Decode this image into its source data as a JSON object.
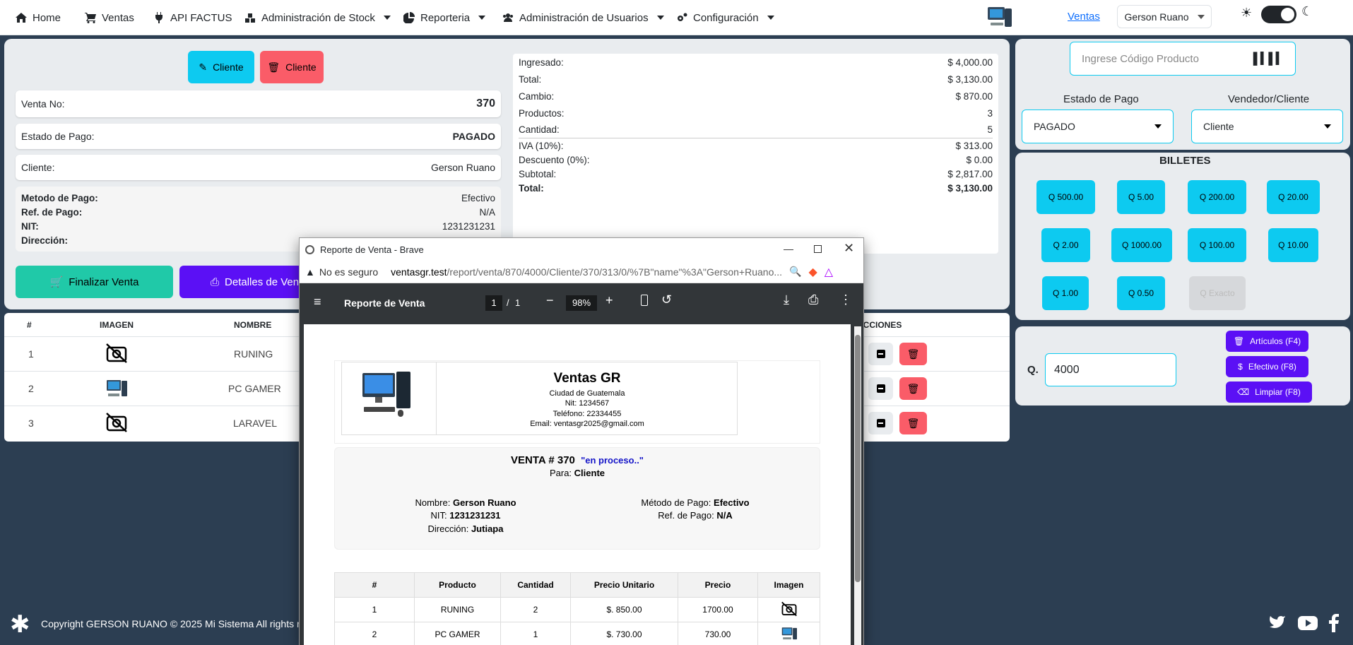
{
  "nav": {
    "home": "Home",
    "ventas": "Ventas",
    "api": "API FACTUS",
    "stock": "Administración de Stock",
    "reporteria": "Reporteria",
    "usuarios": "Administración de Usuarios",
    "config": "Configuración",
    "link_ventas": "Ventas",
    "user": "Gerson Ruano"
  },
  "left": {
    "btn_edit": "Cliente",
    "btn_delete": "Cliente",
    "venta_label": "Venta No:",
    "venta_value": "370",
    "estado_label": "Estado de Pago:",
    "estado_value": "PAGADO",
    "cliente_label": "Cliente:",
    "cliente_value": "Gerson Ruano",
    "metodo_label": "Metodo de Pago:",
    "metodo_value": "Efectivo",
    "ref_label": "Ref. de Pago:",
    "ref_value": "N/A",
    "nit_label": "NIT:",
    "nit_value": "1231231231",
    "dir_label": "Dirección:",
    "dir_value": "",
    "finalizar": "Finalizar Venta",
    "detalles": "Detalles de Venta"
  },
  "summary": {
    "ingresado_label": "Ingresado:",
    "ingresado": "$ 4,000.00",
    "total_label": "Total:",
    "total": "$ 3,130.00",
    "cambio_label": "Cambio:",
    "cambio": "$ 870.00",
    "productos_label": "Productos:",
    "productos": "3",
    "cantidad_label": "Cantidad:",
    "cantidad": "5",
    "iva_label": "IVA (10%):",
    "iva": "$ 313.00",
    "descuento_label": "Descuento (0%):",
    "descuento": "$ 0.00",
    "subtotal_label": "Subtotal:",
    "subtotal": "$ 2,817.00",
    "total2_label": "Total:",
    "total2": "$ 3,130.00"
  },
  "right": {
    "codigo_placeholder": "Ingrese Código Producto",
    "estado_title": "Estado de Pago",
    "estado_value": "PAGADO",
    "vendedor_title": "Vendedor/Cliente",
    "vendedor_value": "Cliente",
    "billetes_title": "BILLETES",
    "bills": [
      "Q 500.00",
      "Q 5.00",
      "Q 200.00",
      "Q 20.00",
      "Q 2.00",
      "Q 1000.00",
      "Q 100.00",
      "Q 10.00",
      "Q 1.00",
      "Q 0.50",
      "Q Exacto"
    ],
    "q_label": "Q.",
    "q_value": "4000",
    "articulos": "Artículos (F4)",
    "efectivo": "Efectivo (F8)",
    "limpiar": "Limpiar (F8)"
  },
  "table": {
    "headers": [
      "#",
      "IMAGEN",
      "NOMBRE",
      "ACCIONES"
    ],
    "rows": [
      {
        "n": "1",
        "name": "RUNING"
      },
      {
        "n": "2",
        "name": "PC GAMER"
      },
      {
        "n": "3",
        "name": "LARAVEL"
      }
    ]
  },
  "footer": {
    "copyright": "Copyright GERSON RUANO © 2025 Mi Sistema All rights re"
  },
  "popup": {
    "title": "Reporte de Venta - Brave",
    "not_secure": "No es seguro",
    "url_host": "ventasgr.test",
    "url_path": "/report/venta/870/4000/Cliente/370/313/0/%7B\"name\"%3A\"Gerson+Ruano...",
    "pdf_title": "Reporte de Venta",
    "page_current": "1",
    "page_sep": "/",
    "page_total": "1",
    "zoom": "98%",
    "company": "Ventas GR",
    "city": "Ciudad de Guatemala",
    "nit": "Nit: 1234567",
    "phone": "Teléfono: 22334455",
    "email": "Email: ventasgr2025@gmail.com",
    "venta_title": "VENTA # 370",
    "status": "\"en proceso..\"",
    "para_label": "Para:",
    "para_value": "Cliente",
    "nombre_label": "Nombre:",
    "nombre_value": "Gerson Ruano",
    "nit_label": "NIT:",
    "nit_value": "1231231231",
    "dir_label": "Dirección:",
    "dir_value": "Jutiapa",
    "metodo_label": "Método de Pago:",
    "metodo_value": "Efectivo",
    "ref_label": "Ref. de Pago:",
    "ref_value": "N/A",
    "cols": [
      "#",
      "Producto",
      "Cantidad",
      "Precio Unitario",
      "Precio",
      "Imagen"
    ],
    "rows": [
      {
        "n": "1",
        "producto": "RUNING",
        "cantidad": "2",
        "unit": "$. 850.00",
        "precio": "1700.00"
      },
      {
        "n": "2",
        "producto": "PC GAMER",
        "cantidad": "1",
        "unit": "$. 730.00",
        "precio": "730.00"
      }
    ]
  },
  "colors": {
    "cyan": "#0dcaf0",
    "red": "#fa5c68",
    "teal": "#20c9a8",
    "purple": "#5b10f5",
    "bg": "#2c3e52"
  }
}
